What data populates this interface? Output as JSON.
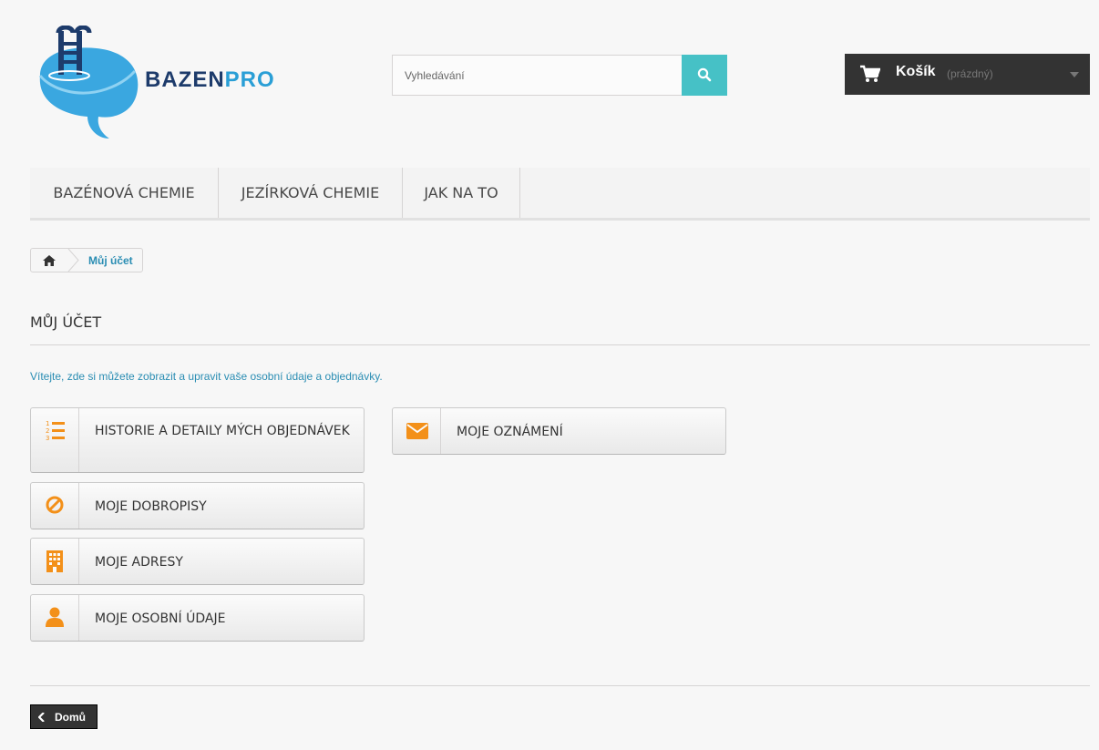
{
  "header": {
    "logo_text_1": "BAZEN",
    "logo_text_2": "PRO",
    "search_placeholder": "Vyhledávání",
    "cart_label": "Košík",
    "cart_status": "(prázdný)"
  },
  "nav": {
    "items": [
      {
        "label": "BAZÉNOVÁ CHEMIE"
      },
      {
        "label": "JEZÍRKOVÁ CHEMIE"
      },
      {
        "label": "JAK NA TO"
      }
    ]
  },
  "breadcrumb": {
    "current": "Můj účet"
  },
  "page": {
    "heading": "MŮJ ÚČET",
    "info": "Vítejte, zde si můžete zobrazit a upravit vaše osobní údaje a objednávky."
  },
  "account_links": [
    {
      "label": "HISTORIE A DETAILY MÝCH OBJEDNÁVEK",
      "icon": "order-list-icon"
    },
    {
      "label": "MOJE OZNÁMENÍ",
      "icon": "envelope-icon"
    },
    {
      "label": "MOJE DOBROPISY",
      "icon": "ban-icon"
    },
    {
      "label": "MOJE ADRESY",
      "icon": "building-icon"
    },
    {
      "label": "MOJE OSOBNÍ ÚDAJE",
      "icon": "user-icon"
    }
  ],
  "footer": {
    "home_label": "Domů"
  },
  "colors": {
    "accent": "#46c1c6",
    "icon_orange": "#f39019",
    "link_blue": "#2a8db3",
    "cart_bg": "#333333"
  }
}
